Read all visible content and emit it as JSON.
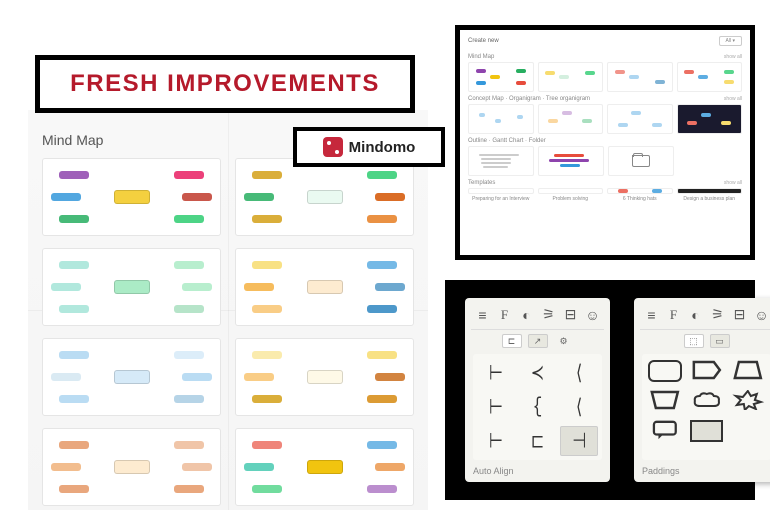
{
  "banner": {
    "title": "FRESH IMPROVEMENTS"
  },
  "logo": {
    "name": "Mindomo"
  },
  "left_gallery": {
    "title": "Mind Map",
    "thumbs": [
      {
        "accent": "#f4d03f",
        "b": [
          "#8e44ad",
          "#27ae60",
          "#e91e63",
          "#2ecc71",
          "#3498db",
          "#c0392b"
        ]
      },
      {
        "accent": "#eafaf1",
        "b": [
          "#d4a017",
          "#d4a017",
          "#2ecc71",
          "#e67e22",
          "#27ae60",
          "#d35400"
        ]
      },
      {
        "accent": "#abebc6",
        "b": [
          "#a3e4d7",
          "#a3e4d7",
          "#abebc6",
          "#a9dfbf",
          "#a3e4d7",
          "#abebc6"
        ]
      },
      {
        "accent": "#fdebd0",
        "b": [
          "#f7dc6f",
          "#f8c471",
          "#5dade2",
          "#2e86c1",
          "#f5b041",
          "#5499c7"
        ]
      },
      {
        "accent": "#d6eaf8",
        "b": [
          "#aed6f1",
          "#aed6f1",
          "#d6eaf8",
          "#a9cce3",
          "#d4e6f1",
          "#aed6f1"
        ]
      },
      {
        "accent": "#fef9e7",
        "b": [
          "#f9e79f",
          "#d4a017",
          "#f7dc6f",
          "#d68910",
          "#f8c471",
          "#ca6f1e"
        ]
      },
      {
        "accent": "#fdebd0",
        "b": [
          "#e59866",
          "#e59866",
          "#edbb99",
          "#e59866",
          "#f0b27a",
          "#edbb99"
        ]
      },
      {
        "accent": "#f1c40f",
        "b": [
          "#ec7063",
          "#58d68d",
          "#5dade2",
          "#af7ac5",
          "#48c9b0",
          "#eb984e"
        ]
      }
    ]
  },
  "top_panel": {
    "header": {
      "title": "Create new",
      "filter": "All"
    },
    "sections": [
      {
        "title": "Mind Map",
        "show_all": "show all"
      },
      {
        "title": "Concept Map · Organigram · Tree organigram",
        "show_all": "show all"
      },
      {
        "title": "Outline · Gantt Chart · Folder",
        "show_all": ""
      },
      {
        "title": "Templates",
        "show_all": "show all"
      }
    ],
    "templates": [
      {
        "label": "Preparing for an Interview"
      },
      {
        "label": "Problem solving"
      },
      {
        "label": "6 Thinking hats"
      },
      {
        "label": "Design a business plan"
      }
    ]
  },
  "tool_panels": {
    "left": {
      "caption": "Auto Align"
    },
    "right": {
      "caption": "Paddings"
    }
  }
}
